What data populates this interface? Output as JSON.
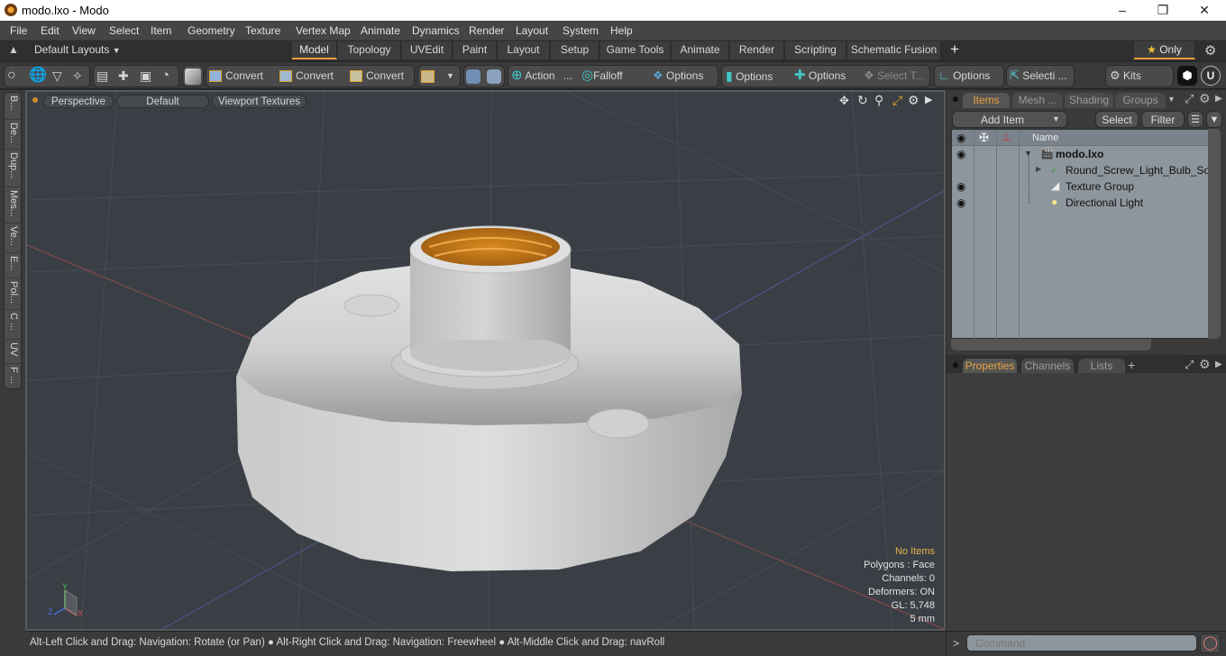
{
  "window": {
    "title": "modo.lxo - Modo",
    "controls": [
      "minimize",
      "restore",
      "close"
    ]
  },
  "menu": [
    "File",
    "Edit",
    "View",
    "Select",
    "Item",
    "Geometry",
    "Texture",
    "Vertex Map",
    "Animate",
    "Dynamics",
    "Render",
    "Layout",
    "System",
    "Help"
  ],
  "layouts": {
    "dropdown_label": "Default Layouts",
    "tabs": [
      "Model",
      "Topology",
      "UVEdit",
      "Paint",
      "Layout",
      "Setup",
      "Game Tools",
      "Animate",
      "Render",
      "Scripting",
      "Schematic Fusion"
    ],
    "active_tab": "Model",
    "add_label": "+",
    "only_label": "Only"
  },
  "toolbar": {
    "convert_labels": [
      "Convert",
      "Convert",
      "Convert"
    ],
    "action_label": "Action",
    "action_more": "...",
    "falloff_label": "Falloff",
    "options_labels": [
      "Options",
      "Options",
      "Options",
      "Options"
    ],
    "select_t_label": "Select T...",
    "selecti_label": "Selecti ...",
    "kits_label": "Kits"
  },
  "left_tabs": [
    "B...",
    "De...",
    "Dup...",
    "Mes...",
    "Ve...",
    "E...",
    "Pol...",
    "C ...",
    "UV",
    "F ..."
  ],
  "viewport": {
    "view_mode": "Perspective",
    "shading": "Default",
    "textures": "Viewport Textures",
    "axis_labels": {
      "x": "X",
      "y": "Y",
      "z": "Z"
    },
    "hud": {
      "selection": "No Items",
      "polygons": "Polygons : Face",
      "channels": "Channels: 0",
      "deformers": "Deformers: ON",
      "gl": "GL: 5,748",
      "grid": "5 mm"
    }
  },
  "status_bar": "Alt-Left Click and Drag: Navigation: Rotate (or Pan) ● Alt-Right Click and Drag: Navigation: Freewheel ● Alt-Middle Click and Drag: navRoll",
  "items_panel": {
    "tabs": [
      "Items",
      "Mesh ...",
      "Shading",
      "Groups"
    ],
    "active_tab": "Items",
    "add_item_label": "Add Item",
    "select_label": "Select",
    "filter_label": "Filter",
    "name_header": "Name",
    "rows": [
      {
        "name": "modo.lxo",
        "visible": true,
        "bold": true,
        "icon": "scene-icon"
      },
      {
        "name": "Round_Screw_Light_Bulb_Soc...",
        "visible": false,
        "bold": false,
        "icon": "mesh-icon"
      },
      {
        "name": "Texture Group",
        "visible": true,
        "bold": false,
        "icon": "texture-group-icon"
      },
      {
        "name": "Directional Light",
        "visible": true,
        "bold": false,
        "icon": "light-icon"
      }
    ]
  },
  "properties_panel": {
    "tabs": [
      "Properties",
      "Channels",
      "Lists"
    ],
    "active_tab": "Properties",
    "add_label": "+"
  },
  "command": {
    "prompt": ">",
    "placeholder": "Command"
  },
  "colors": {
    "accent": "#eaa33d",
    "tree_bg": "#8e969d",
    "viewport_bg": "#3a3f45"
  }
}
